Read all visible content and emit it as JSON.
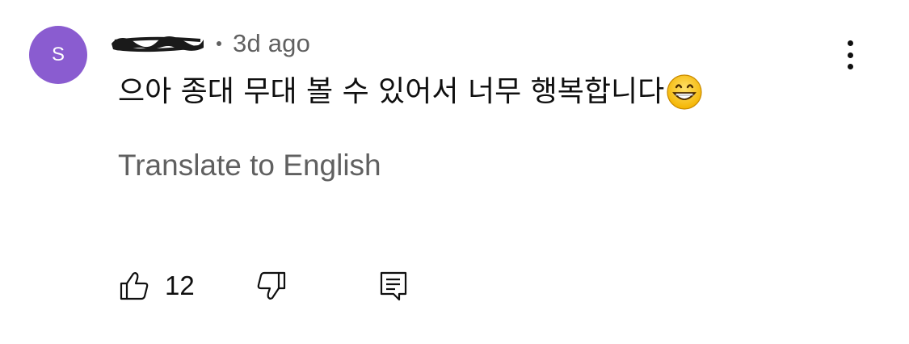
{
  "comment": {
    "avatar_letter": "S",
    "avatar_color": "#8a5cd0",
    "username": "[redacted]",
    "time_ago": "3d ago",
    "text": "으아 종대 무대 볼 수 있어서 너무 행복합니다",
    "emoji": "grinning-face-with-smiling-eyes",
    "translate_label": "Translate to English",
    "like_count": "12"
  },
  "icons": {
    "more": "more-vertical-icon",
    "like": "thumbs-up-icon",
    "dislike": "thumbs-down-icon",
    "reply": "reply-comment-icon"
  },
  "colors": {
    "text_primary": "#0f0f0f",
    "text_secondary": "#606060",
    "background": "#ffffff"
  }
}
